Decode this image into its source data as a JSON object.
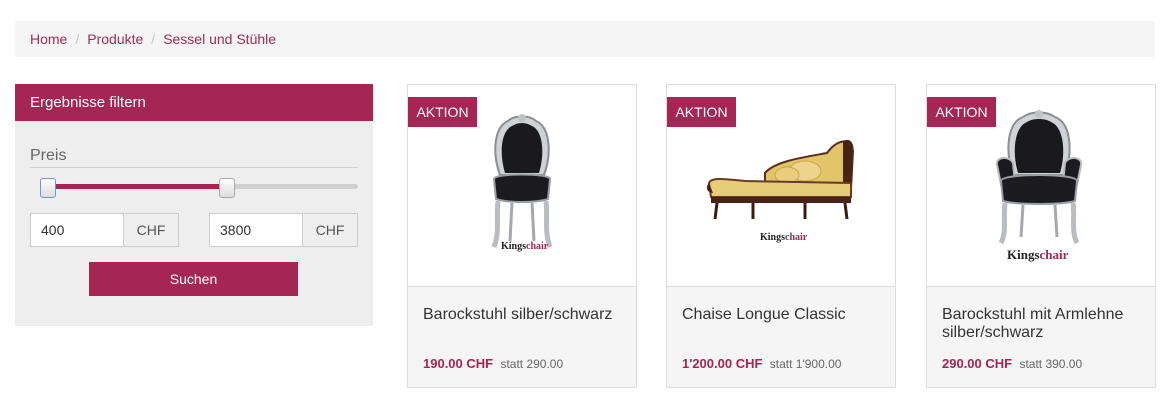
{
  "breadcrumb": {
    "items": [
      "Home",
      "Produkte",
      "Sessel und Stühle"
    ],
    "separator": "/"
  },
  "filter": {
    "title": "Ergebnisse filtern",
    "price_label": "Preis",
    "min_value": "400",
    "max_value": "3800",
    "currency": "CHF",
    "search_label": "Suchen"
  },
  "products": [
    {
      "badge": "AKTION",
      "name": "Barockstuhl silber/schwarz",
      "price": "190.00 CHF",
      "old_price": "statt 290.00",
      "brand_a": "Kings",
      "brand_b": "chair"
    },
    {
      "badge": "AKTION",
      "name": "Chaise Longue Classic",
      "price": "1'200.00 CHF",
      "old_price": "statt 1'900.00",
      "brand_a": "Kings",
      "brand_b": "chair"
    },
    {
      "badge": "AKTION",
      "name": "Barockstuhl mit Armlehne silber/schwarz",
      "price": "290.00 CHF",
      "old_price": "statt 390.00",
      "brand_a": "Kings",
      "brand_b": "chair"
    }
  ],
  "colors": {
    "accent": "#a62653",
    "panel": "#eeeeee"
  }
}
